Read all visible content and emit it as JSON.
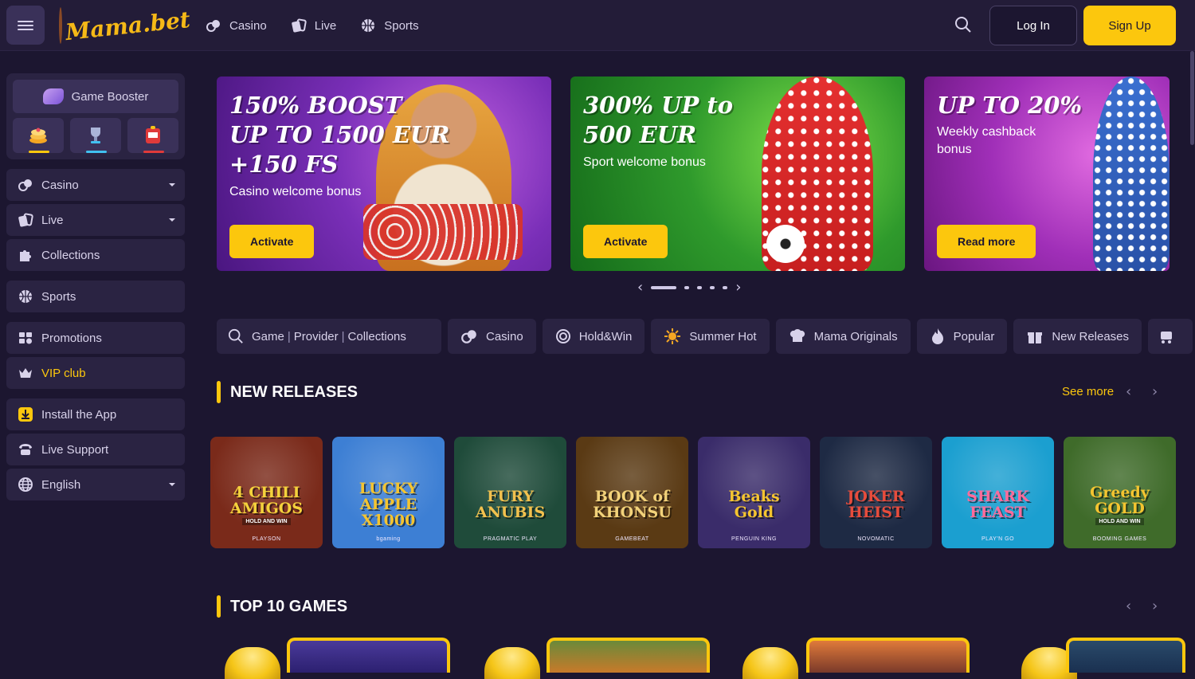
{
  "header": {
    "logo_text": "Mama.bet",
    "nav": [
      {
        "label": "Casino",
        "icon": "casino-chips-icon"
      },
      {
        "label": "Live",
        "icon": "live-cards-icon"
      },
      {
        "label": "Sports",
        "icon": "basketball-icon"
      }
    ],
    "login_label": "Log In",
    "signup_label": "Sign Up"
  },
  "sidebar": {
    "booster_label": "Game Booster",
    "booster_slots": [
      {
        "icon": "pancakes-icon",
        "underline": "#fcc70d"
      },
      {
        "icon": "trophy-icon",
        "underline": "#41c0f0"
      },
      {
        "icon": "slot-machine-icon",
        "underline": "#e03a3a"
      }
    ],
    "items": [
      {
        "label": "Casino",
        "icon": "casino-chips-icon"
      },
      {
        "label": "Live",
        "icon": "live-cards-icon"
      },
      {
        "label": "Collections",
        "icon": "puzzle-icon"
      },
      {
        "label": "Sports",
        "icon": "basketball-icon"
      },
      {
        "label": "Promotions",
        "icon": "promotions-icon"
      },
      {
        "label": "VIP club",
        "icon": "crown-icon"
      },
      {
        "label": "Install the App",
        "icon": "download-icon"
      },
      {
        "label": "Live Support",
        "icon": "phone-icon"
      },
      {
        "label": "English",
        "icon": "globe-icon"
      }
    ]
  },
  "banners": [
    {
      "title": "150% BOOST\nUP TO 1500 EUR\n+150 FS",
      "subtitle": "Casino welcome bonus",
      "button": "Activate"
    },
    {
      "title": "300% UP to\n500 EUR",
      "subtitle": "Sport welcome bonus",
      "button": "Activate"
    },
    {
      "title": "UP TO 20%",
      "subtitle": "Weekly cashback\nbonus",
      "button": "Read more"
    }
  ],
  "carousel": {
    "active_index": 0,
    "count": 5
  },
  "filters": {
    "search_parts": [
      "Game",
      "Provider",
      "Collections"
    ],
    "items": [
      {
        "label": "Casino",
        "icon": "casino-chips-icon"
      },
      {
        "label": "Hold&Win",
        "icon": "hold-win-icon"
      },
      {
        "label": "Summer Hot",
        "icon": "sun-icon"
      },
      {
        "label": "Mama Originals",
        "icon": "chef-hat-icon"
      },
      {
        "label": "Popular",
        "icon": "flame-icon"
      },
      {
        "label": "New Releases",
        "icon": "gift-icon"
      },
      {
        "label": "",
        "icon": "cart-icon"
      }
    ]
  },
  "new_releases": {
    "title": "NEW RELEASES",
    "see_more": "See more",
    "games": [
      {
        "name": "4 CHILI\nAMIGOS",
        "sub": "HOLD AND WIN",
        "provider": "PLAYSON",
        "bg": "#7a2a1a",
        "color": "#f4d23c"
      },
      {
        "name": "LUCKY\nAPPLE\nX1000",
        "provider": "bgaming",
        "bg": "#3d7fd4",
        "color": "#f4c430"
      },
      {
        "name": "FURY\nANUBIS",
        "provider": "PRAGMATIC PLAY",
        "bg": "#1f4b3a",
        "color": "#f2c14e"
      },
      {
        "name": "BOOK of KHONSU",
        "provider": "GAMEBEAT",
        "bg": "#5a3a14",
        "color": "#f2d27a"
      },
      {
        "name": "Beaks\nGold",
        "provider": "PENGUIN KING",
        "bg": "#3a2c6a",
        "color": "#f4c430"
      },
      {
        "name": "JOKER\nHEIST",
        "provider": "NOVOMATIC",
        "bg": "#1e2a44",
        "color": "#e74c3c"
      },
      {
        "name": "SHARK\nFEAST",
        "provider": "PLAY'N GO",
        "bg": "#1b9fd0",
        "color": "#ff6b9a"
      },
      {
        "name": "Greedy\nGOLD",
        "sub": "HOLD AND WIN",
        "provider": "BOOMING GAMES",
        "bg": "#3f6b2a",
        "color": "#f4c430"
      }
    ]
  },
  "top10": {
    "title": "TOP 10 GAMES"
  }
}
